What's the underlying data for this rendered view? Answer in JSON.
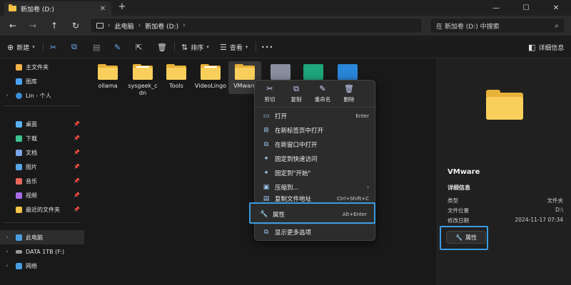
{
  "window": {
    "tab_title": "新加卷 (D:)",
    "tab_close": "✕",
    "new_tab": "+",
    "controls": [
      "—",
      "☐",
      "✕"
    ]
  },
  "address_bar": {
    "back": "←",
    "forward": "→",
    "up": "↑",
    "refresh": "↻",
    "crumbs": [
      "此电脑",
      "新加卷 (D:)"
    ],
    "search_placeholder": "在 新加卷 (D:) 中搜索"
  },
  "toolbar": {
    "new_label": "新建",
    "sort_label": "排序",
    "view_label": "查看",
    "more_label": "•••",
    "details_label": "详细信息"
  },
  "sidebar": {
    "items": [
      {
        "label": "主文件夹",
        "color": "#f4b24a"
      },
      {
        "label": "图库",
        "color": "#4aa3f4"
      },
      {
        "label": "Lin - 个人",
        "color": "#3a8fd8"
      },
      {
        "label": "桌面",
        "color": "#5ab3f0"
      },
      {
        "label": "下载",
        "color": "#3ec28f"
      },
      {
        "label": "文档",
        "color": "#7aa7e8"
      },
      {
        "label": "图片",
        "color": "#58a6e8"
      },
      {
        "label": "音乐",
        "color": "#e8685a"
      },
      {
        "label": "视频",
        "color": "#a86be8"
      },
      {
        "label": "最近的文件夹",
        "color": "#f4c24a"
      },
      {
        "label": "此电脑",
        "color": "#4a9de0"
      },
      {
        "label": "DATA 1TB (F:)",
        "color": "#9a9a9a"
      },
      {
        "label": "网络",
        "color": "#4a9de0"
      }
    ]
  },
  "files": [
    {
      "name": "ollama"
    },
    {
      "name": "sysgeek_cdn"
    },
    {
      "name": "Tools"
    },
    {
      "name": "VideoLingo"
    },
    {
      "name": "VMware"
    }
  ],
  "context_menu": {
    "quick_actions": [
      {
        "label": "剪切",
        "icon": "✂"
      },
      {
        "label": "复制",
        "icon": "⧉"
      },
      {
        "label": "重命名",
        "icon": "✎"
      },
      {
        "label": "删除",
        "icon": "🗑"
      }
    ],
    "items": [
      {
        "label": "打开",
        "shortcut": "Enter",
        "icon": "▭"
      },
      {
        "label": "在新标签页中打开",
        "shortcut": "",
        "icon": "⊞"
      },
      {
        "label": "在新窗口中打开",
        "shortcut": "",
        "icon": "⧉"
      },
      {
        "label": "固定到快速访问",
        "shortcut": "",
        "icon": "✦"
      },
      {
        "label": "固定到\"开始\"",
        "shortcut": "",
        "icon": "✦"
      },
      {
        "label": "压缩到...",
        "shortcut": "›",
        "icon": "▣"
      },
      {
        "label": "复制文件地址",
        "shortcut": "Ctrl+Shift+C",
        "icon": "▤"
      },
      {
        "label": "属性",
        "shortcut": "Alt+Enter",
        "icon": "🔧"
      },
      {
        "label": "显示更多选项",
        "shortcut": "",
        "icon": "⧉"
      }
    ]
  },
  "details": {
    "name": "VMware",
    "section": "详细信息",
    "rows": [
      {
        "key": "类型",
        "value": "文件夹"
      },
      {
        "key": "文件位置",
        "value": "D:\\"
      },
      {
        "key": "修改日期",
        "value": "2024-11-17 07:34"
      }
    ],
    "properties_button": "属性"
  },
  "colors": {
    "accent": "#3b9be0",
    "folder": "#f9cf5c"
  }
}
